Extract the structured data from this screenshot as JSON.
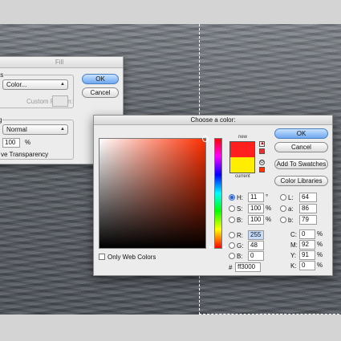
{
  "fill_dialog": {
    "title": "Fill",
    "contents_label": "ts",
    "use_value": "Color...",
    "custom_pattern_label": "Custom Pattern:",
    "blending_label": "g",
    "mode_value": "Normal",
    "opacity_value": "100",
    "opacity_unit": "%",
    "preserve_label": "ve Transparency",
    "ok_label": "OK",
    "cancel_label": "Cancel"
  },
  "color_picker": {
    "title": "Choose a color:",
    "new_label": "new",
    "current_label": "current",
    "new_color": "#ff1f1f",
    "current_color": "#ffee00",
    "buttons": {
      "ok": "OK",
      "cancel": "Cancel",
      "add_to_swatches": "Add To Swatches",
      "color_libraries": "Color Libraries"
    },
    "only_web_colors_label": "Only Web Colors",
    "hsb": [
      {
        "label": "H:",
        "value": "11",
        "unit": "°",
        "selected": true
      },
      {
        "label": "S:",
        "value": "100",
        "unit": "%",
        "selected": false
      },
      {
        "label": "B:",
        "value": "100",
        "unit": "%",
        "selected": false
      }
    ],
    "rgb": [
      {
        "label": "R:",
        "value": "255"
      },
      {
        "label": "G:",
        "value": "48"
      },
      {
        "label": "B:",
        "value": "0"
      }
    ],
    "lab": [
      {
        "label": "L:",
        "value": "64"
      },
      {
        "label": "a:",
        "value": "86"
      },
      {
        "label": "b:",
        "value": "79"
      }
    ],
    "cmyk": [
      {
        "label": "C:",
        "value": "0",
        "unit": "%"
      },
      {
        "label": "M:",
        "value": "92",
        "unit": "%"
      },
      {
        "label": "Y:",
        "value": "91",
        "unit": "%"
      },
      {
        "label": "K:",
        "value": "0",
        "unit": "%"
      }
    ],
    "hex_label": "#",
    "hex_value": "ff3000"
  }
}
